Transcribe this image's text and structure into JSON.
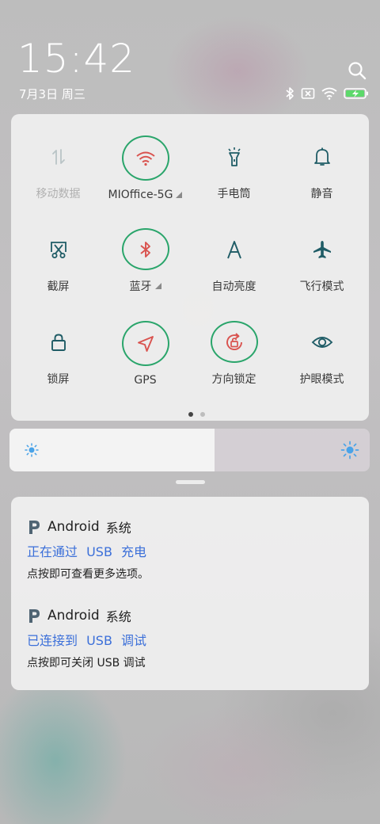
{
  "status": {
    "time": "15:42",
    "date": "7月3日 周三",
    "icons": [
      "bluetooth-icon",
      "no-sim-icon",
      "wifi-icon",
      "battery-charging-icon"
    ]
  },
  "quick_settings": {
    "tiles": [
      {
        "id": "mobile-data",
        "label": "移动数据",
        "icon": "mobile-data-icon",
        "active": false,
        "disabled": true
      },
      {
        "id": "wifi",
        "label": "MIOffice-5G",
        "icon": "wifi-icon",
        "active": true,
        "has_menu": true
      },
      {
        "id": "flashlight",
        "label": "手电筒",
        "icon": "flashlight-icon",
        "active": false
      },
      {
        "id": "mute",
        "label": "静音",
        "icon": "bell-icon",
        "active": false
      },
      {
        "id": "screenshot",
        "label": "截屏",
        "icon": "screenshot-icon",
        "active": false
      },
      {
        "id": "bluetooth",
        "label": "蓝牙",
        "icon": "bluetooth-icon",
        "active": true,
        "has_menu": true
      },
      {
        "id": "auto-brightness",
        "label": "自动亮度",
        "icon": "auto-brightness-icon",
        "active": false
      },
      {
        "id": "airplane",
        "label": "飞行模式",
        "icon": "airplane-icon",
        "active": false
      },
      {
        "id": "lock-screen",
        "label": "锁屏",
        "icon": "lock-icon",
        "active": false
      },
      {
        "id": "gps",
        "label": "GPS",
        "icon": "location-arrow-icon",
        "active": true
      },
      {
        "id": "rotation-lock",
        "label": "方向锁定",
        "icon": "rotation-lock-icon",
        "active": true
      },
      {
        "id": "reading-mode",
        "label": "护眼模式",
        "icon": "eye-icon",
        "active": false
      }
    ],
    "page_count": 2,
    "current_page": 1
  },
  "brightness": {
    "level": 0.57
  },
  "notifications": [
    {
      "app": "Android",
      "source": "系统",
      "title": "正在通过 USB 充电",
      "body": "点按即可查看更多选项。"
    },
    {
      "app": "Android",
      "source": "系统",
      "title": "已连接到 USB 调试",
      "body": "点按即可关闭 USB 调试"
    }
  ],
  "colors": {
    "active_ring": "#2aa56b",
    "active_icon": "#d9534f",
    "inactive_icon": "#1f5c66",
    "link_blue": "#3b6fd9"
  }
}
